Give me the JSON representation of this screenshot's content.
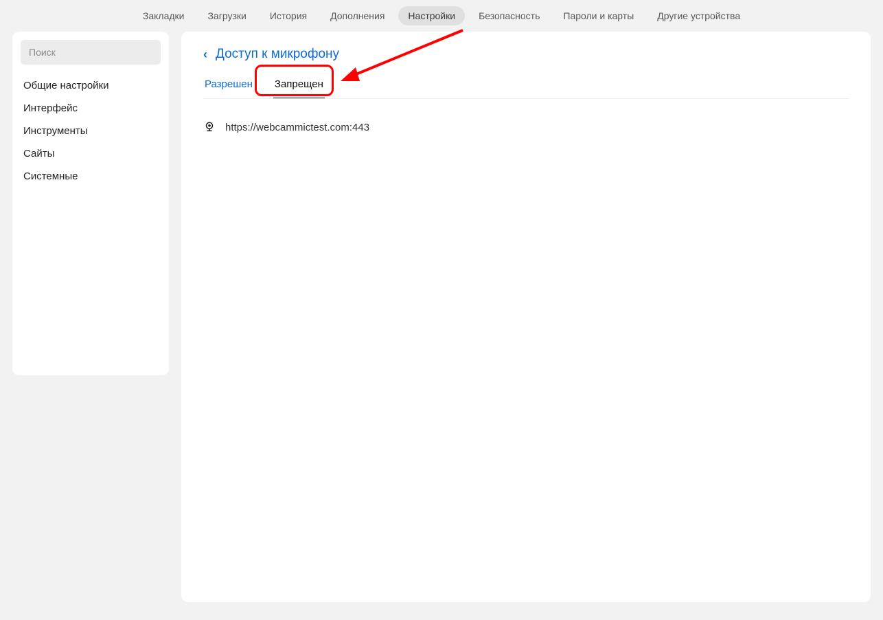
{
  "topnav": {
    "items": [
      "Закладки",
      "Загрузки",
      "История",
      "Дополнения",
      "Настройки",
      "Безопасность",
      "Пароли и карты",
      "Другие устройства"
    ],
    "active_index": 4
  },
  "sidebar": {
    "search_placeholder": "Поиск",
    "items": [
      "Общие настройки",
      "Интерфейс",
      "Инструменты",
      "Сайты",
      "Системные"
    ]
  },
  "main": {
    "back_label": "Доступ к микрофону",
    "tabs": [
      "Разрешен",
      "Запрещен"
    ],
    "active_tab": 1,
    "sites": [
      {
        "icon": "webcam-icon",
        "url": "https://webcammictest.com:443"
      }
    ]
  },
  "annotation": {
    "highlight_tab_index": 1,
    "color": "#ff0000"
  }
}
